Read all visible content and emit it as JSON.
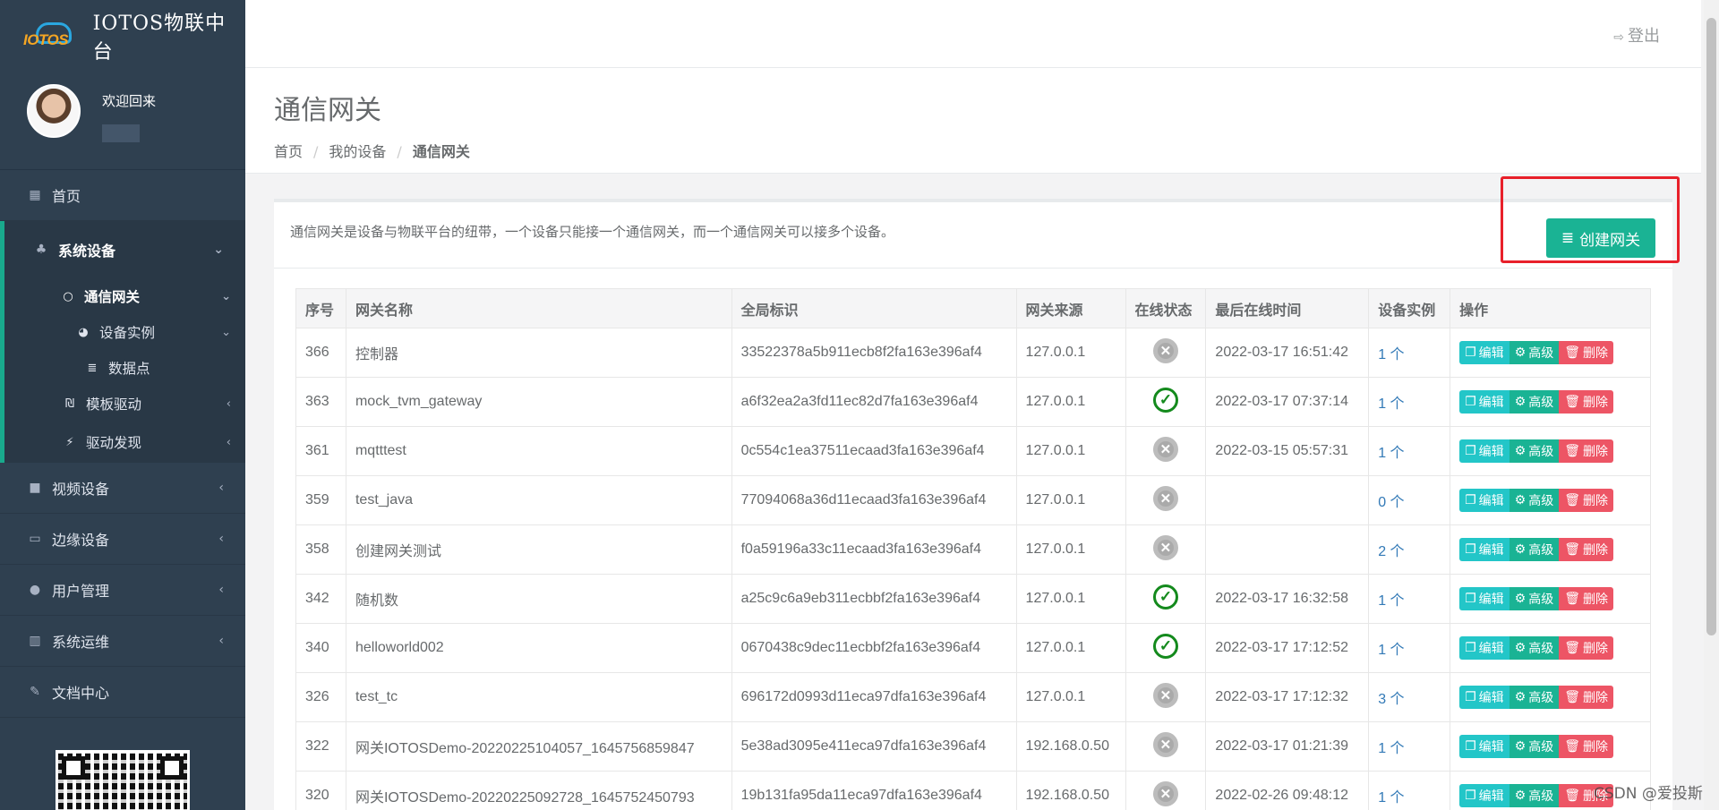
{
  "app": {
    "title": "IOTOS物联中台",
    "logo_text": "IOTOS"
  },
  "user": {
    "welcome": "欢迎回来"
  },
  "sidebar": {
    "home": "首页",
    "system_devices": "系统设备",
    "gateway": "通信网关",
    "device_instance": "设备实例",
    "data_point": "数据点",
    "template_driver": "模板驱动",
    "driver_discovery": "驱动发现",
    "video_devices": "视频设备",
    "edge_devices": "边缘设备",
    "user_mgmt": "用户管理",
    "ops": "系统运维",
    "docs": "文档中心"
  },
  "topbar": {
    "logout": "登出"
  },
  "page": {
    "title": "通信网关",
    "breadcrumb": [
      "首页",
      "我的设备",
      "通信网关"
    ],
    "description": "通信网关是设备与物联平台的纽带，一个设备只能接一个通信网关，而一个通信网关可以接多个设备。",
    "create_button": "创建网关"
  },
  "table": {
    "headers": [
      "序号",
      "网关名称",
      "全局标识",
      "网关来源",
      "在线状态",
      "最后在线时间",
      "设备实例",
      "操作"
    ],
    "actions": {
      "edit": "编辑",
      "advanced": "高级",
      "delete": "删除"
    },
    "rows": [
      {
        "id": "366",
        "name": "控制器",
        "uid": "33522378a5b911ecb8f2fa163e396af4",
        "source": "127.0.0.1",
        "online": false,
        "last": "2022-03-17 16:51:42",
        "count": "1 个"
      },
      {
        "id": "363",
        "name": "mock_tvm_gateway",
        "uid": "a6f32ea2a3fd11ec82d7fa163e396af4",
        "source": "127.0.0.1",
        "online": true,
        "last": "2022-03-17 07:37:14",
        "count": "1 个"
      },
      {
        "id": "361",
        "name": "mqtttest",
        "uid": "0c554c1ea37511ecaad3fa163e396af4",
        "source": "127.0.0.1",
        "online": false,
        "last": "2022-03-15 05:57:31",
        "count": "1 个"
      },
      {
        "id": "359",
        "name": "test_java",
        "uid": "77094068a36d11ecaad3fa163e396af4",
        "source": "127.0.0.1",
        "online": false,
        "last": "",
        "count": "0 个"
      },
      {
        "id": "358",
        "name": "创建网关测试",
        "uid": "f0a59196a33c11ecaad3fa163e396af4",
        "source": "127.0.0.1",
        "online": false,
        "last": "",
        "count": "2 个"
      },
      {
        "id": "342",
        "name": "随机数",
        "uid": "a25c9c6a9eb311ecbbf2fa163e396af4",
        "source": "127.0.0.1",
        "online": true,
        "last": "2022-03-17 16:32:58",
        "count": "1 个"
      },
      {
        "id": "340",
        "name": "helloworld002",
        "uid": "0670438c9dec11ecbbf2fa163e396af4",
        "source": "127.0.0.1",
        "online": true,
        "last": "2022-03-17 17:12:52",
        "count": "1 个"
      },
      {
        "id": "326",
        "name": "test_tc",
        "uid": "696172d0993d11eca97dfa163e396af4",
        "source": "127.0.0.1",
        "online": false,
        "last": "2022-03-17 17:12:32",
        "count": "3 个"
      },
      {
        "id": "322",
        "name": "网关IOTOSDemo-20220225104057_1645756859847",
        "uid": "5e38ad3095e411eca97dfa163e396af4",
        "source": "192.168.0.50",
        "online": false,
        "last": "2022-03-17 01:21:39",
        "count": "1 个"
      },
      {
        "id": "320",
        "name": "网关IOTOSDemo-20220225092728_1645752450793",
        "uid": "19b131fa95da11eca97dfa163e396af4",
        "source": "192.168.0.50",
        "online": false,
        "last": "2022-02-26 09:48:12",
        "count": "1 个"
      }
    ]
  },
  "watermark": "CSDN @爱投斯"
}
